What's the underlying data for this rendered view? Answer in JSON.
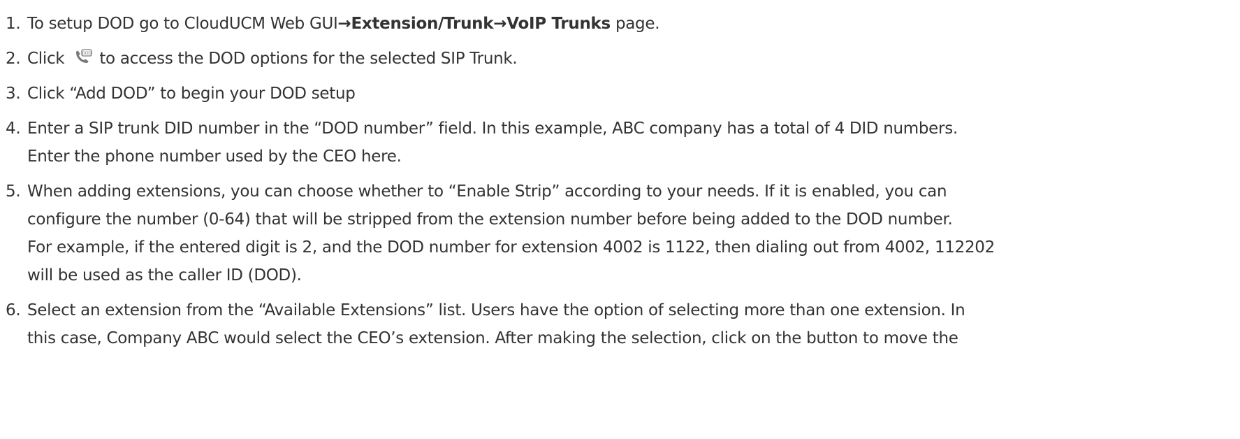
{
  "steps": [
    {
      "num": "1.",
      "pre": "To setup DOD go to CloudUCM Web GUI",
      "arrow1": "→",
      "bold1": "Extension/Trunk",
      "arrow2": "→",
      "bold2": "VoIP Trunks",
      "post": " page."
    },
    {
      "num": "2.",
      "pre": "Click",
      "icon": "dod-phone-icon",
      "icon_text": "DOD",
      "post": "to access the DOD options for the selected SIP Trunk."
    },
    {
      "num": "3.",
      "text": "Click “Add DOD” to begin your DOD setup"
    },
    {
      "num": "4.",
      "line1": "Enter a SIP trunk DID number in the “DOD number” field. In this example, ABC company has a total of 4 DID numbers.",
      "line2": "Enter the phone number used by the CEO here."
    },
    {
      "num": "5.",
      "line1": "When adding extensions, you can choose whether to “Enable Strip” according to your needs. If it is enabled, you can",
      "line2": "configure the number (0-64) that will be stripped from the extension number before being added to the DOD number.",
      "line3": "For example, if the entered digit is 2, and the DOD number for extension 4002 is 1122, then dialing out from 4002, 112202",
      "line4": "will be used as the caller ID (DOD)."
    },
    {
      "num": "6.",
      "line1": "Select an extension from the “Available Extensions” list. Users have the option of selecting more than one extension. In",
      "line2": "this case, Company ABC would select the CEO’s extension. After making the selection, click on the button to move the"
    }
  ],
  "colors": {
    "text": "#333333",
    "icon_accent": "#4a86c8"
  }
}
